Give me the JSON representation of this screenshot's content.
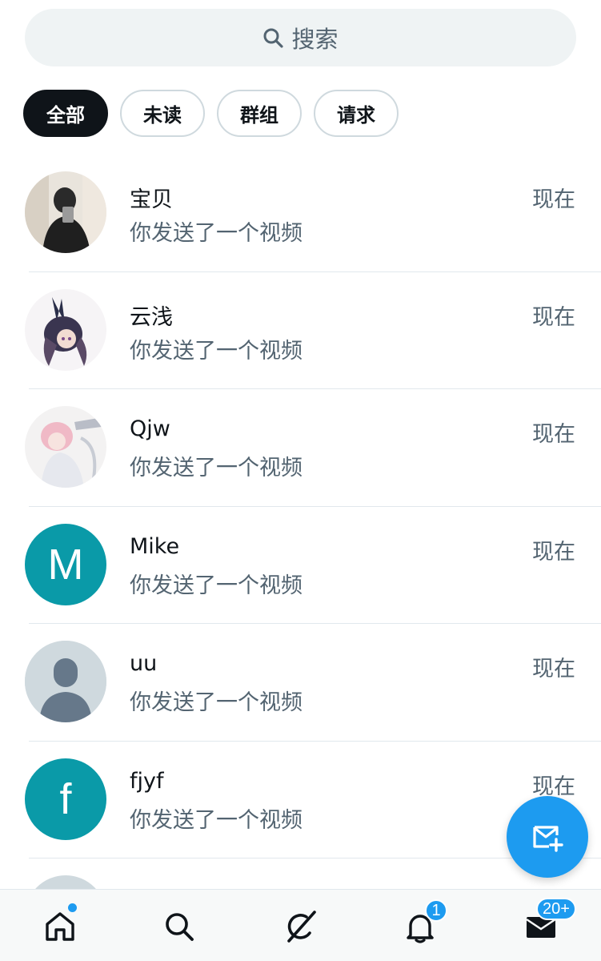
{
  "search": {
    "placeholder": "搜索",
    "icon": "search-icon"
  },
  "filters": [
    {
      "label": "全部",
      "active": true
    },
    {
      "label": "未读",
      "active": false
    },
    {
      "label": "群组",
      "active": false
    },
    {
      "label": "请求",
      "active": false
    }
  ],
  "conversations": [
    {
      "name": "宝贝",
      "preview": "你发送了一个视频",
      "time": "现在",
      "avatar": "photo"
    },
    {
      "name": "云浅",
      "preview": "你发送了一个视频",
      "time": "现在",
      "avatar": "photo"
    },
    {
      "name": "Qjw",
      "preview": "你发送了一个视频",
      "time": "现在",
      "avatar": "photo"
    },
    {
      "name": "Mike",
      "preview": "你发送了一个视频",
      "time": "现在",
      "avatar_letter": "M",
      "avatar_color": "#0a9aa8"
    },
    {
      "name": "uu",
      "preview": "你发送了一个视频",
      "time": "现在",
      "avatar": "default-person"
    },
    {
      "name": "fjyf",
      "preview": "你发送了一个视频",
      "time": "现在",
      "avatar_letter": "f",
      "avatar_color": "#0a9aa8"
    }
  ],
  "fab": {
    "icon": "new-message-icon"
  },
  "bottom_nav": {
    "items": [
      {
        "icon": "home-icon",
        "has_dot": true
      },
      {
        "icon": "search-icon"
      },
      {
        "icon": "grok-icon"
      },
      {
        "icon": "bell-icon",
        "badge": "1"
      },
      {
        "icon": "mail-icon",
        "badge": "20+"
      }
    ]
  },
  "colors": {
    "accent": "#1d9bf0",
    "text_primary": "#0f1419",
    "text_secondary": "#536471",
    "teal_avatar": "#0a9aa8"
  }
}
